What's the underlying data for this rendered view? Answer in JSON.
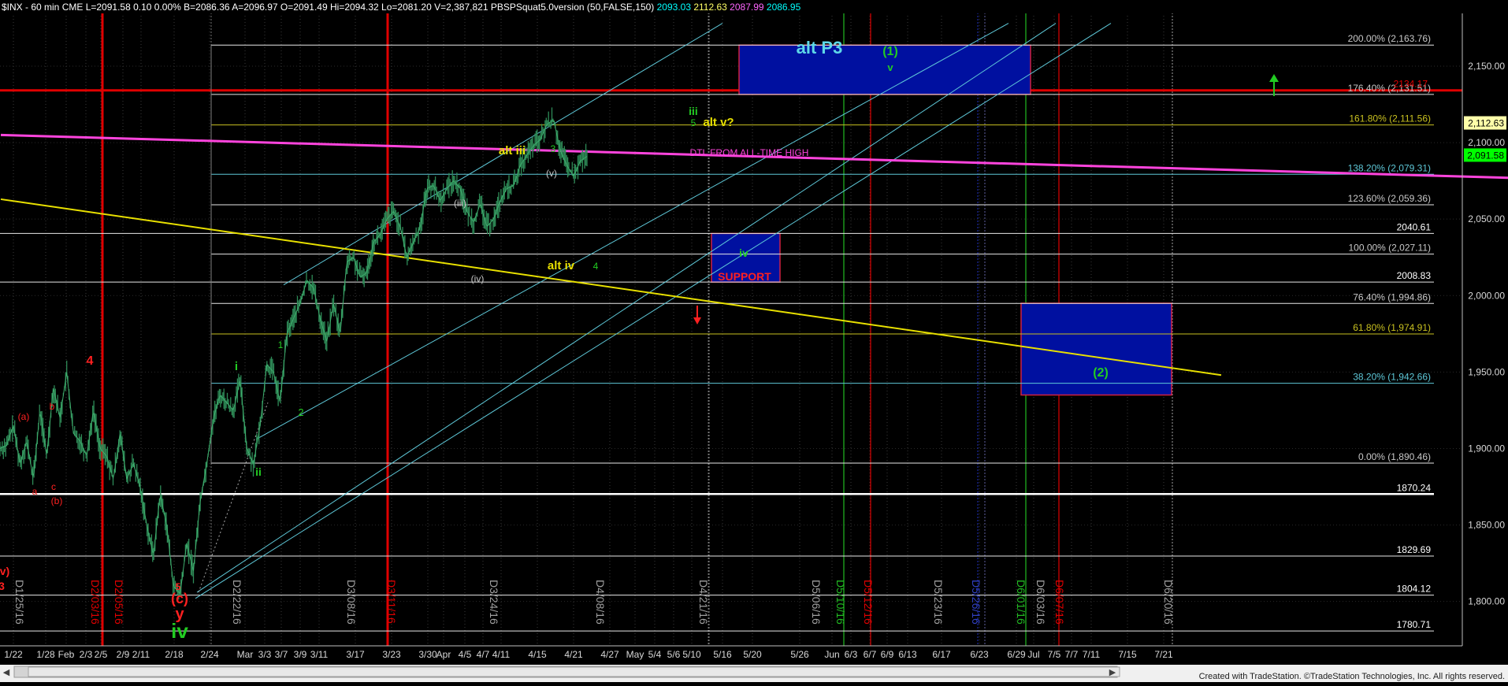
{
  "header": {
    "parts": [
      {
        "text": "$INX - 60 min  CME  L=2091.58  0.10  0.00%",
        "color": "#ffffff"
      },
      {
        "text": "  B=2086.36  A=2096.97  O=2091.49  Hi=2094.32  Lo=2081.20  V=2,387,821  PBSPSquat5.0version (50,FALSE,150)",
        "color": "#ffffff"
      },
      {
        "text": "  2093.03",
        "color": "#00ffff"
      },
      {
        "text": "  2112.63",
        "color": "#ffff66"
      },
      {
        "text": "  2087.99",
        "color": "#ff66ff"
      },
      {
        "text": "  2086.95",
        "color": "#00ffff"
      }
    ]
  },
  "footer": {
    "credit": "Created with TradeStation. ©TradeStation Technologies, Inc. All rights reserved."
  },
  "colors": {
    "background": "#000000",
    "price": "#2e8b57",
    "fib": "#e8e8e8",
    "channel": "#5ec8d8",
    "dtl": "#ff44dd",
    "support_line": "#e8e000",
    "red_line": "#e00000",
    "green_vline": "#22bb22",
    "blue_box": "#0010a0",
    "label_green": "#22cc22",
    "label_yellow": "#e8e000",
    "label_red": "#ff2020",
    "label_cyan": "#5ed8e8"
  },
  "chart_data": {
    "type": "line",
    "title": "$INX - 60 min",
    "ylim": [
      1771,
      2185
    ],
    "y_ticks": [
      "2,150.00",
      "2,100.00",
      "2,050.00",
      "2,000.00",
      "1,950.00",
      "1,900.00",
      "1,850.00",
      "1,800.00"
    ],
    "y_tick_values": [
      2150,
      2100,
      2050,
      2000,
      1950,
      1900,
      1850,
      1800
    ],
    "x_ticks": [
      "1/22",
      "1/28",
      "Feb",
      "2/3",
      "2/5",
      "2/9",
      "2/11",
      "2/18",
      "2/24",
      "Mar",
      "3/3",
      "3/7",
      "3/9",
      "3/11",
      "3/17",
      "3/23",
      "3/30",
      "Apr",
      "4/5",
      "4/7",
      "4/11",
      "4/15",
      "4/21",
      "4/27",
      "May",
      "5/4",
      "5/6",
      "5/10",
      "5/16",
      "5/20",
      "5/26",
      "Jun",
      "6/3",
      "6/7",
      "6/9",
      "6/13",
      "6/17",
      "6/23",
      "6/29",
      "Jul",
      "7/5",
      "7/7",
      "7/11",
      "7/15",
      "7/21"
    ],
    "price_path": {
      "x_start": "1/22",
      "x_end": "4/21",
      "waypoints": [
        [
          1900,
          1902
        ],
        [
          1915,
          1890
        ],
        [
          1905,
          1880
        ],
        [
          1925,
          1895
        ],
        [
          1940,
          1920
        ],
        [
          1950,
          1910
        ],
        [
          1905,
          1895
        ],
        [
          1925,
          1900
        ],
        [
          1895,
          1880
        ],
        [
          1910,
          1880
        ],
        [
          1890,
          1875
        ],
        [
          1850,
          1830
        ],
        [
          1870,
          1850
        ],
        [
          1810,
          1805
        ],
        [
          1838,
          1820
        ],
        [
          1865,
          1890
        ],
        [
          1920,
          1935
        ],
        [
          1930,
          1925
        ],
        [
          1945,
          1900
        ],
        [
          1890,
          1915
        ],
        [
          1955,
          1950
        ],
        [
          1930,
          1975
        ],
        [
          1985,
          1995
        ],
        [
          2010,
          2005
        ],
        [
          1985,
          1970
        ],
        [
          1995,
          1975
        ],
        [
          2022,
          2025
        ],
        [
          2012,
          2015
        ],
        [
          2035,
          2040
        ],
        [
          2050,
          2055
        ],
        [
          2045,
          2025
        ],
        [
          2035,
          2045
        ],
        [
          2070,
          2072
        ],
        [
          2062,
          2070
        ],
        [
          2075,
          2070
        ],
        [
          2055,
          2048
        ],
        [
          2060,
          2045
        ],
        [
          2050,
          2062
        ],
        [
          2070,
          2072
        ],
        [
          2085,
          2092
        ],
        [
          2098,
          2102
        ],
        [
          2112,
          2115
        ],
        [
          2095,
          2085
        ],
        [
          2078,
          2088
        ],
        [
          2091
        ]
      ]
    },
    "last_price": 2091.58,
    "price_labels": [
      {
        "text": "2,112.63",
        "value": 2112.63,
        "bg": "#ffffaa"
      },
      {
        "text": "2,091.58",
        "value": 2091.58,
        "bg": "#00ff00"
      }
    ],
    "fib_levels": [
      {
        "label": "200.00% (2,163.76)",
        "value": 2163.76,
        "color": "#e8e8e8",
        "label_color": "#c8c8c8"
      },
      {
        "label": "176.40% (2,131.51)",
        "value": 2131.51,
        "color": "#e8e8e8",
        "label_color": "#c8c8c8"
      },
      {
        "label": "161.80% (2,111.56)",
        "value": 2111.56,
        "color": "#c8c020",
        "label_color": "#c8c020"
      },
      {
        "label": "138.20% (2,079.31)",
        "value": 2079.31,
        "color": "#5ec8d8",
        "label_color": "#5ec8d8"
      },
      {
        "label": "123.60% (2,059.36)",
        "value": 2059.36,
        "color": "#e8e8e8",
        "label_color": "#c8c8c8"
      },
      {
        "label": "2040.61",
        "value": 2040.61,
        "color": "#e8e8e8",
        "label_color": "#ffffff"
      },
      {
        "label": "100.00% (2,027.11)",
        "value": 2027.11,
        "color": "#e8e8e8",
        "label_color": "#c8c8c8"
      },
      {
        "label": "2008.83",
        "value": 2008.83,
        "color": "#e8e8e8",
        "label_color": "#ffffff"
      },
      {
        "label": "76.40% (1,994.86)",
        "value": 1994.86,
        "color": "#e8e8e8",
        "label_color": "#c8c8c8"
      },
      {
        "label": "61.80% (1,974.91)",
        "value": 1974.91,
        "color": "#c8c020",
        "label_color": "#c8c020"
      },
      {
        "label": "38.20% (1,942.66)",
        "value": 1942.66,
        "color": "#5ec8d8",
        "label_color": "#5ec8d8"
      },
      {
        "label": "0.00% (1,890.46)",
        "value": 1890.46,
        "color": "#e8e8e8",
        "label_color": "#c8c8c8"
      },
      {
        "label": "1870.24",
        "value": 1870.24,
        "color": "#ffffff",
        "label_color": "#ffffff"
      },
      {
        "label": "1829.69",
        "value": 1829.69,
        "color": "#e8e8e8",
        "label_color": "#ffffff"
      },
      {
        "label": "1804.12",
        "value": 1804.12,
        "color": "#e8e8e8",
        "label_color": "#ffffff"
      },
      {
        "label": "1780.71",
        "value": 1780.71,
        "color": "#e8e8e8",
        "label_color": "#ffffff"
      }
    ],
    "red_level": {
      "text": "2134.17",
      "value": 2134.17
    },
    "trend_lines": [
      {
        "name": "DTL FROM ALL-TIME HIGH",
        "color": "#ff44dd",
        "from": [
          1,
          2105
        ],
        "to": [
          1914,
          2077
        ]
      },
      {
        "name": "",
        "color": "#e8e000",
        "from": [
          1,
          2063
        ],
        "to": [
          1550,
          1948
        ]
      }
    ],
    "vertical_lines": [
      {
        "x_label": "2/3/16",
        "color": "#e00000"
      },
      {
        "x_label": "3/11/16",
        "color": "#e00000"
      },
      {
        "x_label": "5/10/16",
        "color": "#22bb22"
      },
      {
        "x_label": "5/12/16",
        "color": "#e00000"
      },
      {
        "x_label": "6/01/16",
        "color": "#22bb22"
      },
      {
        "x_label": "6/07/16",
        "color": "#e00000"
      }
    ],
    "date_markers": [
      "D1/25/16",
      "D2/03/16",
      "D2/05/16",
      "D2/22/16",
      "D3/08/16",
      "D3/11/16",
      "D3/24/16",
      "D4/08/16",
      "D4/21/16",
      "D5/06/16",
      "D5/10/16",
      "D5/12/16",
      "D5/23/16",
      "D5/26/16",
      "D6/01/16",
      "D6/03/16",
      "D6/07/16",
      "D6/20/16"
    ],
    "boxes": [
      {
        "name": "alt-p3-target",
        "y_range": [
          2131.51,
          2163.76
        ]
      },
      {
        "name": "support-box",
        "label": "SUPPORT",
        "y_range": [
          2008.83,
          2040.61
        ]
      },
      {
        "name": "wave-2-box",
        "y_range": [
          1935,
          1995
        ]
      }
    ],
    "annotations": [
      {
        "text": "alt  P3",
        "color": "#5ed8e8"
      },
      {
        "text": "(1)",
        "color": "#22cc22"
      },
      {
        "text": "v",
        "color": "#22cc22"
      },
      {
        "text": "iii",
        "color": "#22cc22"
      },
      {
        "text": "5",
        "color": "#22cc22"
      },
      {
        "text": "alt v?",
        "color": "#e8e000"
      },
      {
        "text": "alt iii",
        "color": "#e8e000"
      },
      {
        "text": "3",
        "color": "#22cc22"
      },
      {
        "text": "DTL FROM ALL-TIME HIGH",
        "color": "#ff44dd"
      },
      {
        "text": "(v)",
        "color": "#c8c8c8"
      },
      {
        "text": "(iii)",
        "color": "#c8c8c8"
      },
      {
        "text": "(iv)",
        "color": "#c8c8c8"
      },
      {
        "text": "alt iv",
        "color": "#e8e000"
      },
      {
        "text": "4",
        "color": "#22cc22"
      },
      {
        "text": "iv",
        "color": "#22cc22"
      },
      {
        "text": "SUPPORT",
        "color": "#ff2020"
      },
      {
        "text": "(2)",
        "color": "#22cc22"
      },
      {
        "text": "i",
        "color": "#22cc22"
      },
      {
        "text": "1",
        "color": "#22cc22"
      },
      {
        "text": "2",
        "color": "#22cc22"
      },
      {
        "text": "ii",
        "color": "#22cc22"
      },
      {
        "text": "4",
        "color": "#ff2020"
      },
      {
        "text": "(a)",
        "color": "#ff2020"
      },
      {
        "text": "b",
        "color": "#ff2020"
      },
      {
        "text": "a",
        "color": "#ff2020"
      },
      {
        "text": "c",
        "color": "#ff2020"
      },
      {
        "text": "(b)",
        "color": "#ff2020"
      },
      {
        "text": "5",
        "color": "#ff2020"
      },
      {
        "text": "(c)",
        "color": "#ff2020"
      },
      {
        "text": "y",
        "color": "#ff2020"
      },
      {
        "text": "iv",
        "color": "#22cc22"
      },
      {
        "text": "v)",
        "color": "#ff2020"
      },
      {
        "text": "3",
        "color": "#ff2020"
      }
    ],
    "arrows": [
      {
        "direction": "up",
        "color": "#22cc22"
      },
      {
        "direction": "down",
        "color": "#ff2020"
      }
    ],
    "grid": true
  }
}
